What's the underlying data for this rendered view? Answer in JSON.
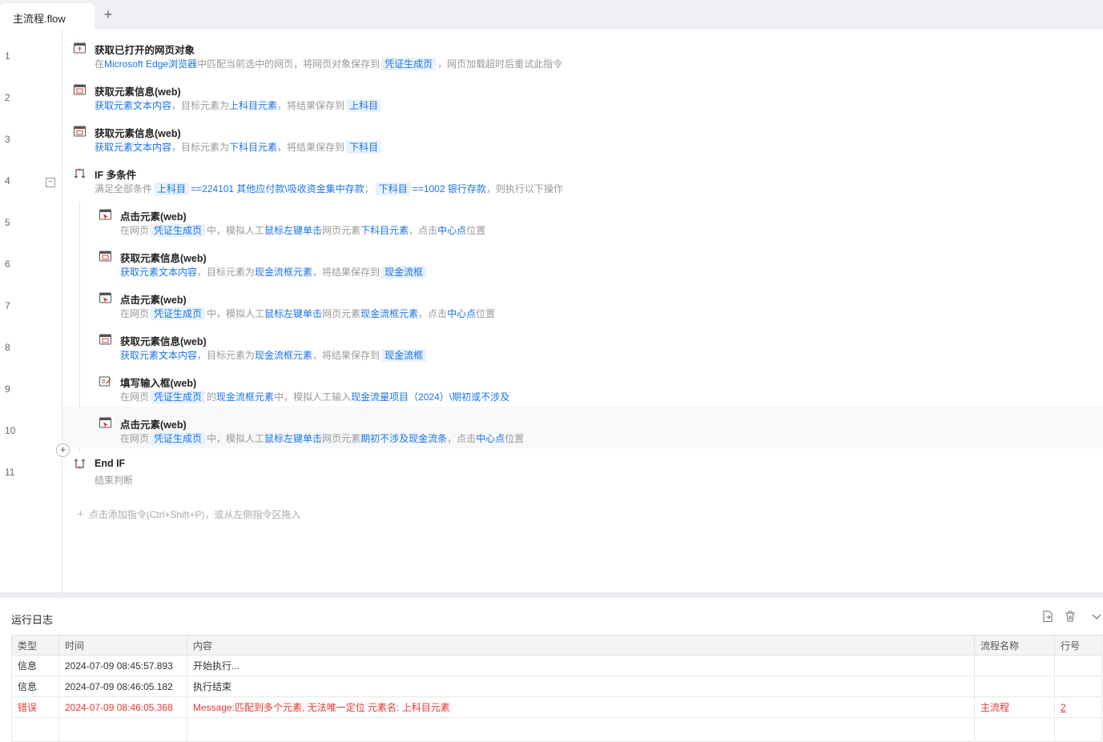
{
  "tabs": [
    {
      "label": "主流程.flow"
    }
  ],
  "flow": {
    "rows": [
      {
        "line": "1",
        "title": "获取已打开的网页对象",
        "desc": [
          [
            "t",
            "在"
          ],
          [
            "l",
            "Microsoft Edge浏览器"
          ],
          [
            "t",
            "中匹配当前选中的网页，将网页对象保存到"
          ],
          [
            "v",
            "凭证生成页"
          ],
          [
            "t",
            "，网页加载超时后重试此指令"
          ]
        ]
      },
      {
        "line": "2",
        "title": "获取元素信息(web)",
        "desc": [
          [
            "l",
            "获取元素文本内容"
          ],
          [
            "t",
            "，目标元素为"
          ],
          [
            "l",
            "上科目元素"
          ],
          [
            "t",
            "，将结果保存到"
          ],
          [
            "v",
            "上科目"
          ]
        ]
      },
      {
        "line": "3",
        "title": "获取元素信息(web)",
        "desc": [
          [
            "l",
            "获取元素文本内容"
          ],
          [
            "t",
            "，目标元素为"
          ],
          [
            "l",
            "下科目元素"
          ],
          [
            "t",
            "，将结果保存到"
          ],
          [
            "v",
            "下科目"
          ]
        ]
      },
      {
        "line": "4",
        "title": "IF 多条件",
        "desc": [
          [
            "t",
            "满足全部条件"
          ],
          [
            "v",
            "上科目"
          ],
          [
            "l",
            "==224101 其他应付款\\吸收资金集中存款"
          ],
          [
            "t",
            "；"
          ],
          [
            "v",
            "下科目"
          ],
          [
            "l",
            "==1002 银行存款"
          ],
          [
            "t",
            "，则执行以下操作"
          ]
        ]
      },
      {
        "line": "5",
        "title": "点击元素(web)",
        "desc": [
          [
            "t",
            "在网页"
          ],
          [
            "v",
            "凭证生成页"
          ],
          [
            "t",
            "中，模拟人工"
          ],
          [
            "l",
            "鼠标左键单击"
          ],
          [
            "t",
            "网页元素"
          ],
          [
            "l",
            "下科目元素"
          ],
          [
            "t",
            "，点击"
          ],
          [
            "l",
            "中心点"
          ],
          [
            "t",
            "位置"
          ]
        ]
      },
      {
        "line": "6",
        "title": "获取元素信息(web)",
        "desc": [
          [
            "l",
            "获取元素文本内容"
          ],
          [
            "t",
            "，目标元素为"
          ],
          [
            "l",
            "现金流框元素"
          ],
          [
            "t",
            "，将结果保存到"
          ],
          [
            "v",
            "现金流框"
          ]
        ]
      },
      {
        "line": "7",
        "title": "点击元素(web)",
        "desc": [
          [
            "t",
            "在网页"
          ],
          [
            "v",
            "凭证生成页"
          ],
          [
            "t",
            "中，模拟人工"
          ],
          [
            "l",
            "鼠标左键单击"
          ],
          [
            "t",
            "网页元素"
          ],
          [
            "l",
            "现金流框元素"
          ],
          [
            "t",
            "，点击"
          ],
          [
            "l",
            "中心点"
          ],
          [
            "t",
            "位置"
          ]
        ]
      },
      {
        "line": "8",
        "title": "获取元素信息(web)",
        "desc": [
          [
            "l",
            "获取元素文本内容"
          ],
          [
            "t",
            "，目标元素为"
          ],
          [
            "l",
            "现金流框元素"
          ],
          [
            "t",
            "，将结果保存到"
          ],
          [
            "v",
            "现金流框"
          ]
        ]
      },
      {
        "line": "9",
        "title": "填写输入框(web)",
        "desc": [
          [
            "t",
            "在网页"
          ],
          [
            "v",
            "凭证生成页"
          ],
          [
            "t",
            "的"
          ],
          [
            "l",
            "现金流框元素"
          ],
          [
            "t",
            "中，模拟人工输入"
          ],
          [
            "l",
            "现金流量项目（2024）\\期初或不涉及"
          ]
        ]
      },
      {
        "line": "10",
        "title": "点击元素(web)",
        "desc": [
          [
            "t",
            "在网页"
          ],
          [
            "v",
            "凭证生成页"
          ],
          [
            "t",
            "中，模拟人工"
          ],
          [
            "l",
            "鼠标左键单击"
          ],
          [
            "t",
            "网页元素"
          ],
          [
            "l",
            "期初不涉及现金流条"
          ],
          [
            "t",
            "，点击"
          ],
          [
            "l",
            "中心点"
          ],
          [
            "t",
            "位置"
          ]
        ]
      },
      {
        "line": "11",
        "title": "End IF",
        "desc": [
          [
            "t",
            "结束判断"
          ]
        ]
      }
    ],
    "add_hint": "点击添加指令(Ctrl+Shift+P)，或从左侧指令区拖入"
  },
  "log": {
    "title": "运行日志",
    "columns": [
      "类型",
      "时间",
      "内容",
      "流程名称",
      "行号"
    ],
    "rows": [
      {
        "type": "信息",
        "time": "2024-07-09 08:45:57.893",
        "content": "开始执行...",
        "flow": "",
        "line": ""
      },
      {
        "type": "信息",
        "time": "2024-07-09 08:46:05.182",
        "content": "执行结束",
        "flow": "",
        "line": ""
      },
      {
        "type": "错误",
        "time": "2024-07-09 08:46:05.368",
        "content": "Message:匹配到多个元素, 无法唯一定位 元素名: 上科目元素",
        "flow": "主流程",
        "line": "2"
      }
    ]
  },
  "colors": {
    "link": "#1a73e8",
    "error": "#e53935",
    "var_bg": "#e8f2fd"
  }
}
